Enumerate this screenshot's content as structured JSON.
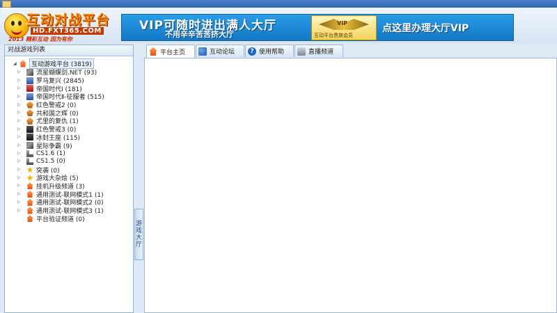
{
  "header": {
    "logo_title": "互动对战平台",
    "logo_url": "HD.FXT365.COM",
    "logo_slogan": "2013 精彩互动 因为有你",
    "banner_main": "VIP可随时进出满人大厅",
    "banner_sub": "不用辛辛苦苦挤大厅",
    "badge_vip": "VIP",
    "badge_text": "互动平台贵族会员",
    "banner_cta": "点这里办理大厅VIP"
  },
  "left_panel": {
    "title": "对战游戏列表",
    "root": "互动游戏平台 (3819)",
    "items": [
      {
        "label": "流星蝴蝶剑.NET (93)",
        "icon": "sword-game-icon"
      },
      {
        "label": "罗马复兴 (2845)",
        "icon": "rome-game-icon"
      },
      {
        "label": "帝国时代Ⅰ (181)",
        "icon": "empire-game-icon"
      },
      {
        "label": "帝国时代Ⅱ-征服者 (515)",
        "icon": "empire2-game-icon"
      },
      {
        "label": "红色警戒2 (0)",
        "icon": "red-alert-game-icon"
      },
      {
        "label": "共和国之辉 (0)",
        "icon": "republic-game-icon"
      },
      {
        "label": "尤里的复仇 (1)",
        "icon": "yuri-game-icon"
      },
      {
        "label": "红色警戒3 (0)",
        "icon": "red-alert3-game-icon"
      },
      {
        "label": "冰封王座 (115)",
        "icon": "frozen-throne-game-icon"
      },
      {
        "label": "星际争霸 (9)",
        "icon": "starcraft-game-icon"
      },
      {
        "label": "CS1.6 (1)",
        "icon": "cs-game-icon"
      },
      {
        "label": "CS1.5 (0)",
        "icon": "cs-game-icon"
      },
      {
        "label": "突袭 (0)",
        "icon": "star-game-icon"
      },
      {
        "label": "游戏大杂烩 (5)",
        "icon": "star-game-icon"
      },
      {
        "label": "挂机升级频道 (3)",
        "icon": "home-channel-icon"
      },
      {
        "label": "通用测试-联网模式1 (1)",
        "icon": "home-channel-icon"
      },
      {
        "label": "通用测试-联网模式2 (0)",
        "icon": "home-channel-icon"
      },
      {
        "label": "通用测试-联网模式3 (1)",
        "icon": "home-channel-icon"
      },
      {
        "label": "平台验证频道 (0)",
        "icon": "home-channel-icon"
      }
    ]
  },
  "splitter": {
    "label": "游戏大厅"
  },
  "tabs": [
    {
      "label": "平台主页",
      "icon": "home-icon",
      "active": true
    },
    {
      "label": "互动论坛",
      "icon": "forum-icon",
      "active": false
    },
    {
      "label": "使用帮助",
      "icon": "help-icon",
      "active": false
    },
    {
      "label": "直播频道",
      "icon": "live-icon",
      "active": false
    }
  ],
  "help_glyph": "?"
}
